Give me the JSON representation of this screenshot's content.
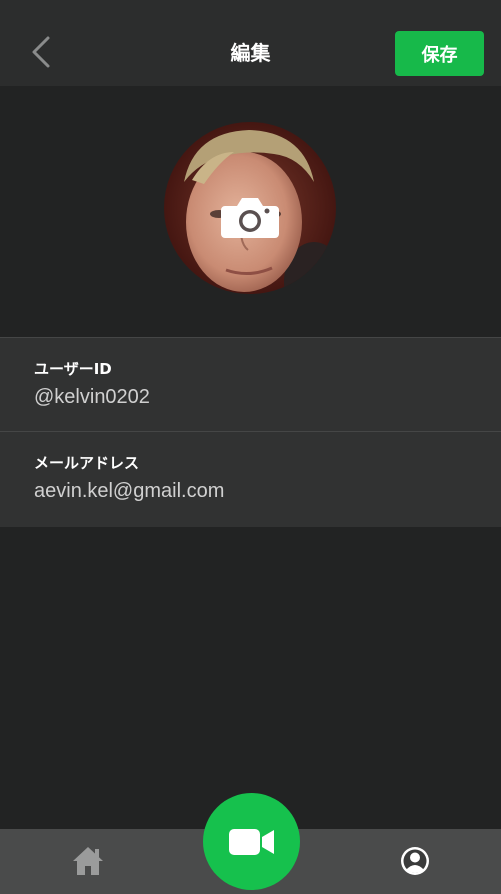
{
  "header": {
    "title": "編集",
    "save_label": "保存",
    "back_icon": "chevron-left-icon"
  },
  "profile": {
    "avatar": "profile-photo",
    "camera_icon": "camera-icon"
  },
  "fields": [
    {
      "label": "ユーザーID",
      "value": "@kelvin0202"
    },
    {
      "label": "メールアドレス",
      "value": "aevin.kel@gmail.com"
    }
  ],
  "bottom_nav": {
    "home_icon": "home-icon",
    "video_icon": "video-camera-icon",
    "profile_icon": "profile-icon"
  },
  "colors": {
    "accent": "#17b94a",
    "background": "#222323",
    "header": "#2c2d2d",
    "nav": "#4a4b4b"
  }
}
